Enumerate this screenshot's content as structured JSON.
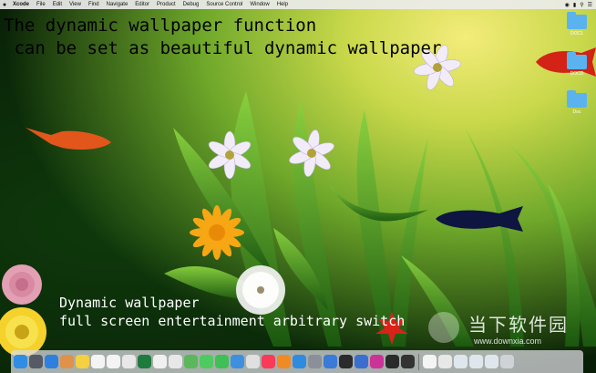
{
  "menubar": {
    "app_name": "Xcode",
    "items": [
      "File",
      "Edit",
      "View",
      "Find",
      "Navigate",
      "Editor",
      "Product",
      "Debug",
      "Source Control",
      "Window",
      "Help"
    ]
  },
  "captions": {
    "line1": "The dynamic wallpaper function",
    "line2": " can be set as beautiful dynamic wallpaper",
    "line3": "Dynamic wallpaper",
    "line4": "full screen entertainment arbitrary switch"
  },
  "desktop_icons": [
    {
      "label": "DOC1"
    },
    {
      "label": "DOCD"
    },
    {
      "label": "Doc"
    }
  ],
  "watermark": {
    "title": "当下软件园",
    "url": "www.downxia.com"
  },
  "dock_apps": [
    {
      "icon": "finder-icon",
      "color": "#2f8de4"
    },
    {
      "icon": "launchpad-icon",
      "color": "#555a66"
    },
    {
      "icon": "safari-icon",
      "color": "#2f7fe0"
    },
    {
      "icon": "photo-icon",
      "color": "#e0914a"
    },
    {
      "icon": "notes-icon",
      "color": "#f5d041"
    },
    {
      "icon": "calendar-icon",
      "color": "#f4f4f4"
    },
    {
      "icon": "reminders-icon",
      "color": "#f4f4f4"
    },
    {
      "icon": "textedit-icon",
      "color": "#e8e8e8"
    },
    {
      "icon": "excel-icon",
      "color": "#1f7a3e"
    },
    {
      "icon": "list-icon",
      "color": "#f0f0f0"
    },
    {
      "icon": "chrome-icon",
      "color": "#e8e8e8"
    },
    {
      "icon": "maps-icon",
      "color": "#5ab85a"
    },
    {
      "icon": "messages-icon",
      "color": "#4ecb5e"
    },
    {
      "icon": "facetime-icon",
      "color": "#3fbf55"
    },
    {
      "icon": "preview-icon",
      "color": "#3e8fe0"
    },
    {
      "icon": "keynote-icon",
      "color": "#e0e0e0"
    },
    {
      "icon": "music-icon",
      "color": "#fa3a58"
    },
    {
      "icon": "books-icon",
      "color": "#f08a24"
    },
    {
      "icon": "appstore-icon",
      "color": "#2e8be0"
    },
    {
      "icon": "settings-icon",
      "color": "#8a8f99"
    },
    {
      "icon": "xcode-icon",
      "color": "#3a7ad8"
    },
    {
      "icon": "terminal-icon",
      "color": "#2b2b2b"
    },
    {
      "icon": "simulator-icon",
      "color": "#3a6fd0"
    },
    {
      "icon": "flower-app-icon",
      "color": "#cc3399"
    },
    {
      "icon": "grid-icon",
      "color": "#2b2b2b"
    },
    {
      "icon": "console-icon",
      "color": "#333333"
    }
  ],
  "dock_right": [
    {
      "icon": "document-icon",
      "color": "#f4f4f4"
    },
    {
      "icon": "document-icon",
      "color": "#e8e8e8"
    },
    {
      "icon": "window-icon",
      "color": "#dfe6ee"
    },
    {
      "icon": "window-icon",
      "color": "#dfe6ee"
    },
    {
      "icon": "window-icon",
      "color": "#dfe6ee"
    },
    {
      "icon": "trash-icon",
      "color": "#cfd3d8"
    }
  ]
}
